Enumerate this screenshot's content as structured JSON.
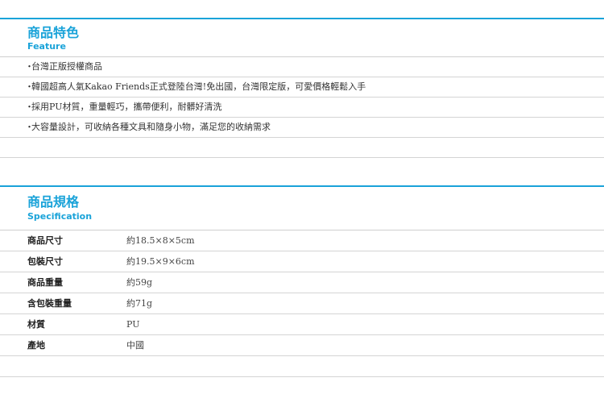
{
  "feature": {
    "title": "商品特色",
    "subtitle": "Feature",
    "items": [
      "台灣正版授權商品",
      "韓國超高人氣Kakao Friends正式登陸台灣!免出國，台灣限定版，可愛價格輕鬆入手",
      "採用PU材質，重量輕巧，攜帶便利，耐髒好清洗",
      "大容量設計，可收納各種文具和隨身小物，滿足您的收納需求"
    ],
    "bullet": "・"
  },
  "spec": {
    "title": "商品規格",
    "subtitle": "Specification",
    "rows": [
      {
        "label": "商品尺寸",
        "value": "約18.5×8×5cm"
      },
      {
        "label": "包裝尺寸",
        "value": "約19.5×9×6cm"
      },
      {
        "label": "商品重量",
        "value": "約59g"
      },
      {
        "label": "含包裝重量",
        "value": "約71g"
      },
      {
        "label": "材質",
        "value": "PU"
      },
      {
        "label": "產地",
        "value": "中國"
      }
    ]
  },
  "colors": {
    "accent": "#1aa3d9",
    "divider": "#d4d4d4"
  }
}
